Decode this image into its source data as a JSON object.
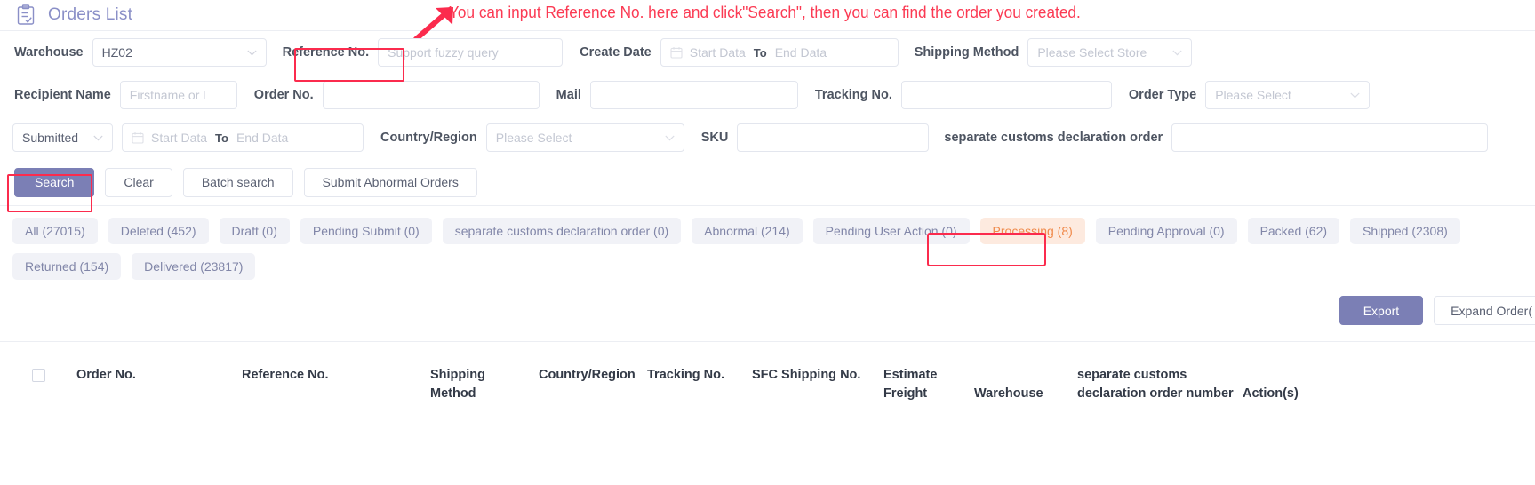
{
  "header": {
    "title": "Orders List",
    "icon": "clipboard-list-icon"
  },
  "annotation": {
    "text": "You can input Reference No. here and click\"Search\", then you can find the order you created.",
    "color": "#fb3a53",
    "arrow": "arrow-up-right-icon"
  },
  "filters": {
    "row1": {
      "warehouse_label": "Warehouse",
      "warehouse_value": "HZ02",
      "reference_label": "Reference No.",
      "reference_placeholder": "Support fuzzy query",
      "create_date_label": "Create Date",
      "start_placeholder": "Start Data",
      "to_label": "To",
      "end_placeholder": "End Data",
      "shipping_method_label": "Shipping Method",
      "shipping_method_placeholder": "Please Select Store"
    },
    "row2": {
      "recipient_label": "Recipient Name",
      "recipient_placeholder": "Firstname or l",
      "order_no_label": "Order No.",
      "order_no_value": "",
      "mail_label": "Mail",
      "mail_value": "",
      "tracking_label": "Tracking No.",
      "tracking_value": "",
      "order_type_label": "Order Type",
      "order_type_placeholder": "Please Select"
    },
    "row3": {
      "status_value": "Submitted",
      "start_placeholder": "Start Data",
      "to_label": "To",
      "end_placeholder": "End Data",
      "country_label": "Country/Region",
      "country_placeholder": "Please Select",
      "sku_label": "SKU",
      "sku_value": "",
      "customs_label": "separate customs declaration order",
      "customs_value": ""
    }
  },
  "buttons": {
    "search": "Search",
    "clear": "Clear",
    "batch_search": "Batch search",
    "submit_abnormal": "Submit Abnormal Orders",
    "search_color": "#7b7fb5"
  },
  "tabs": [
    {
      "label": "All (27015)",
      "active": false
    },
    {
      "label": "Deleted (452)",
      "active": false
    },
    {
      "label": "Draft (0)",
      "active": false
    },
    {
      "label": "Pending Submit (0)",
      "active": false
    },
    {
      "label": "separate customs declaration order (0)",
      "active": false
    },
    {
      "label": "Abnormal (214)",
      "active": false
    },
    {
      "label": "Pending User Action (0)",
      "active": false
    },
    {
      "label": "Processing (8)",
      "active": true
    },
    {
      "label": "Pending Approval (0)",
      "active": false
    },
    {
      "label": "Packed (62)",
      "active": false
    },
    {
      "label": "Shipped (2308)",
      "active": false
    },
    {
      "label": "Returned (154)",
      "active": false
    },
    {
      "label": "Delivered (23817)",
      "active": false
    }
  ],
  "actions": {
    "export": "Export",
    "expand": "Expand Order("
  },
  "table": {
    "columns": [
      "Order No.",
      "Reference No.",
      "Shipping Method",
      "Country/Region",
      "Tracking No.",
      "SFC Shipping No.",
      "Estimate Freight",
      "Warehouse",
      "separate customs declaration order number",
      "Action(s)"
    ]
  }
}
